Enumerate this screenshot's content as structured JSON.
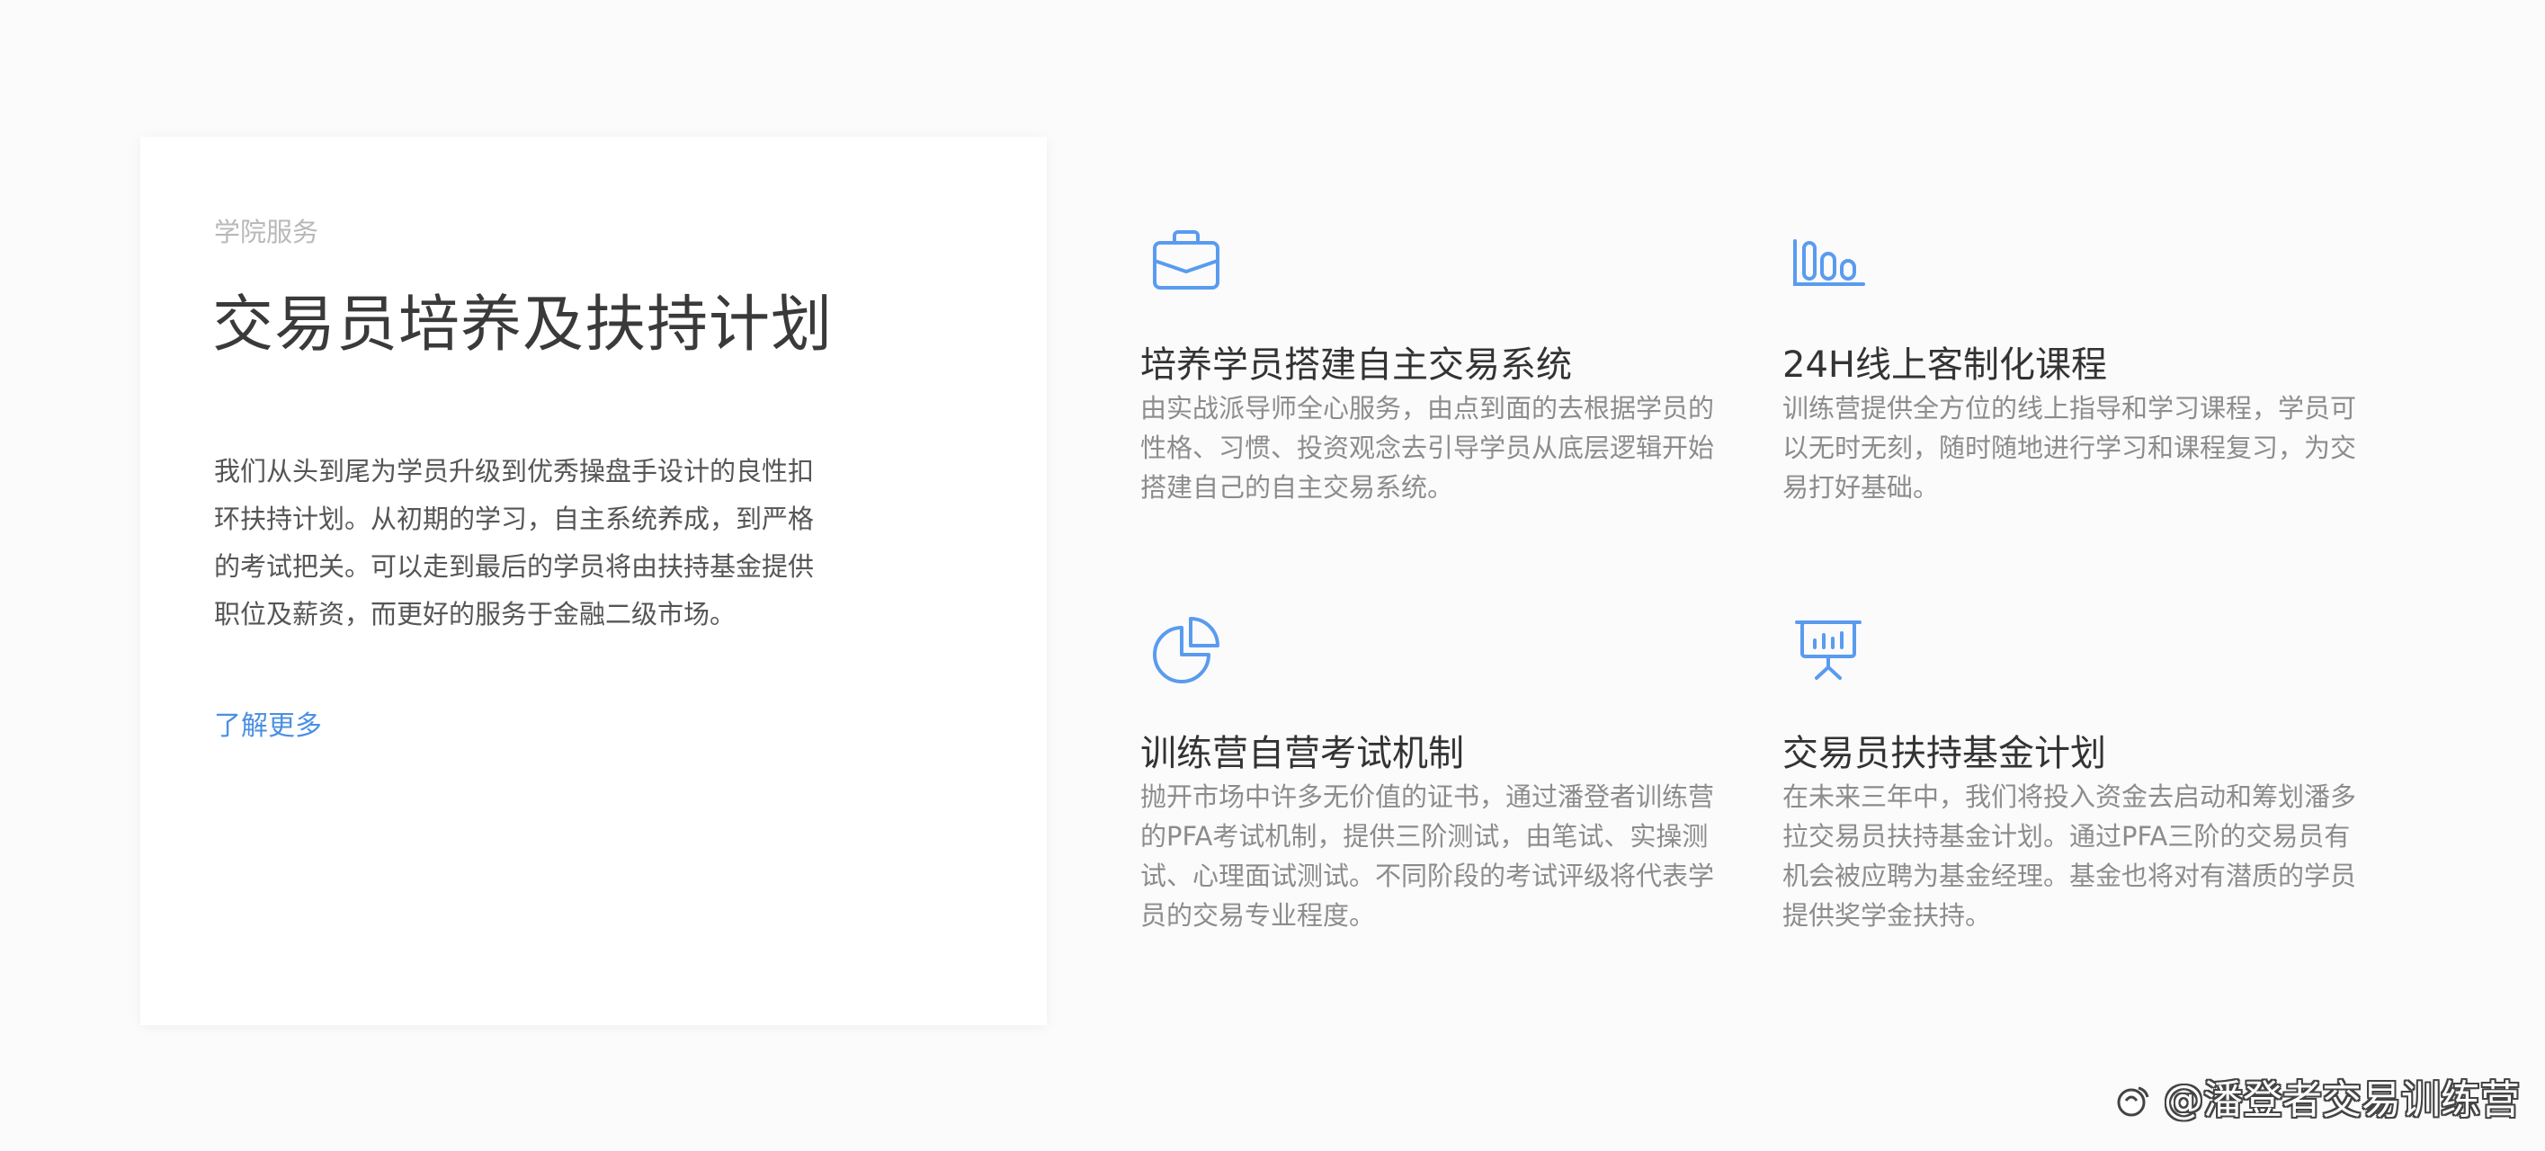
{
  "intro": {
    "eyebrow": "学院服务",
    "title": "交易员培养及扶持计划",
    "description": "我们从头到尾为学员升级到优秀操盘手设计的良性扣环扶持计划。从初期的学习，自主系统养成，到严格的考试把关。可以走到最后的学员将由扶持基金提供职位及薪资，而更好的服务于金融二级市场。",
    "learn_more": "了解更多"
  },
  "features": [
    {
      "icon": "briefcase-icon",
      "title": "培养学员搭建自主交易系统",
      "description": "由实战派导师全心服务，由点到面的去根据学员的性格、习惯、投资观念去引导学员从底层逻辑开始搭建自己的自主交易系统。"
    },
    {
      "icon": "bar-chart-icon",
      "title": "24H线上客制化课程",
      "description": "训练营提供全方位的线上指导和学习课程，学员可以无时无刻，随时随地进行学习和课程复习，为交易打好基础。"
    },
    {
      "icon": "pie-chart-icon",
      "title": "训练营自营考试机制",
      "description": "抛开市场中许多无价值的证书，通过潘登者训练营的PFA考试机制，提供三阶测试，由笔试、实操测试、心理面试测试。不同阶段的考试评级将代表学员的交易专业程度。"
    },
    {
      "icon": "presentation-board-icon",
      "title": "交易员扶持基金计划",
      "description": "在未来三年中，我们将投入资金去启动和筹划潘多拉交易员扶持基金计划。通过PFA三阶的交易员有机会被应聘为基金经理。基金也将对有潜质的学员提供奖学金扶持。"
    }
  ],
  "watermark": {
    "text": "@潘登者交易训练营"
  },
  "colors": {
    "accent": "#4a90e2",
    "icon": "#5a9bef"
  }
}
